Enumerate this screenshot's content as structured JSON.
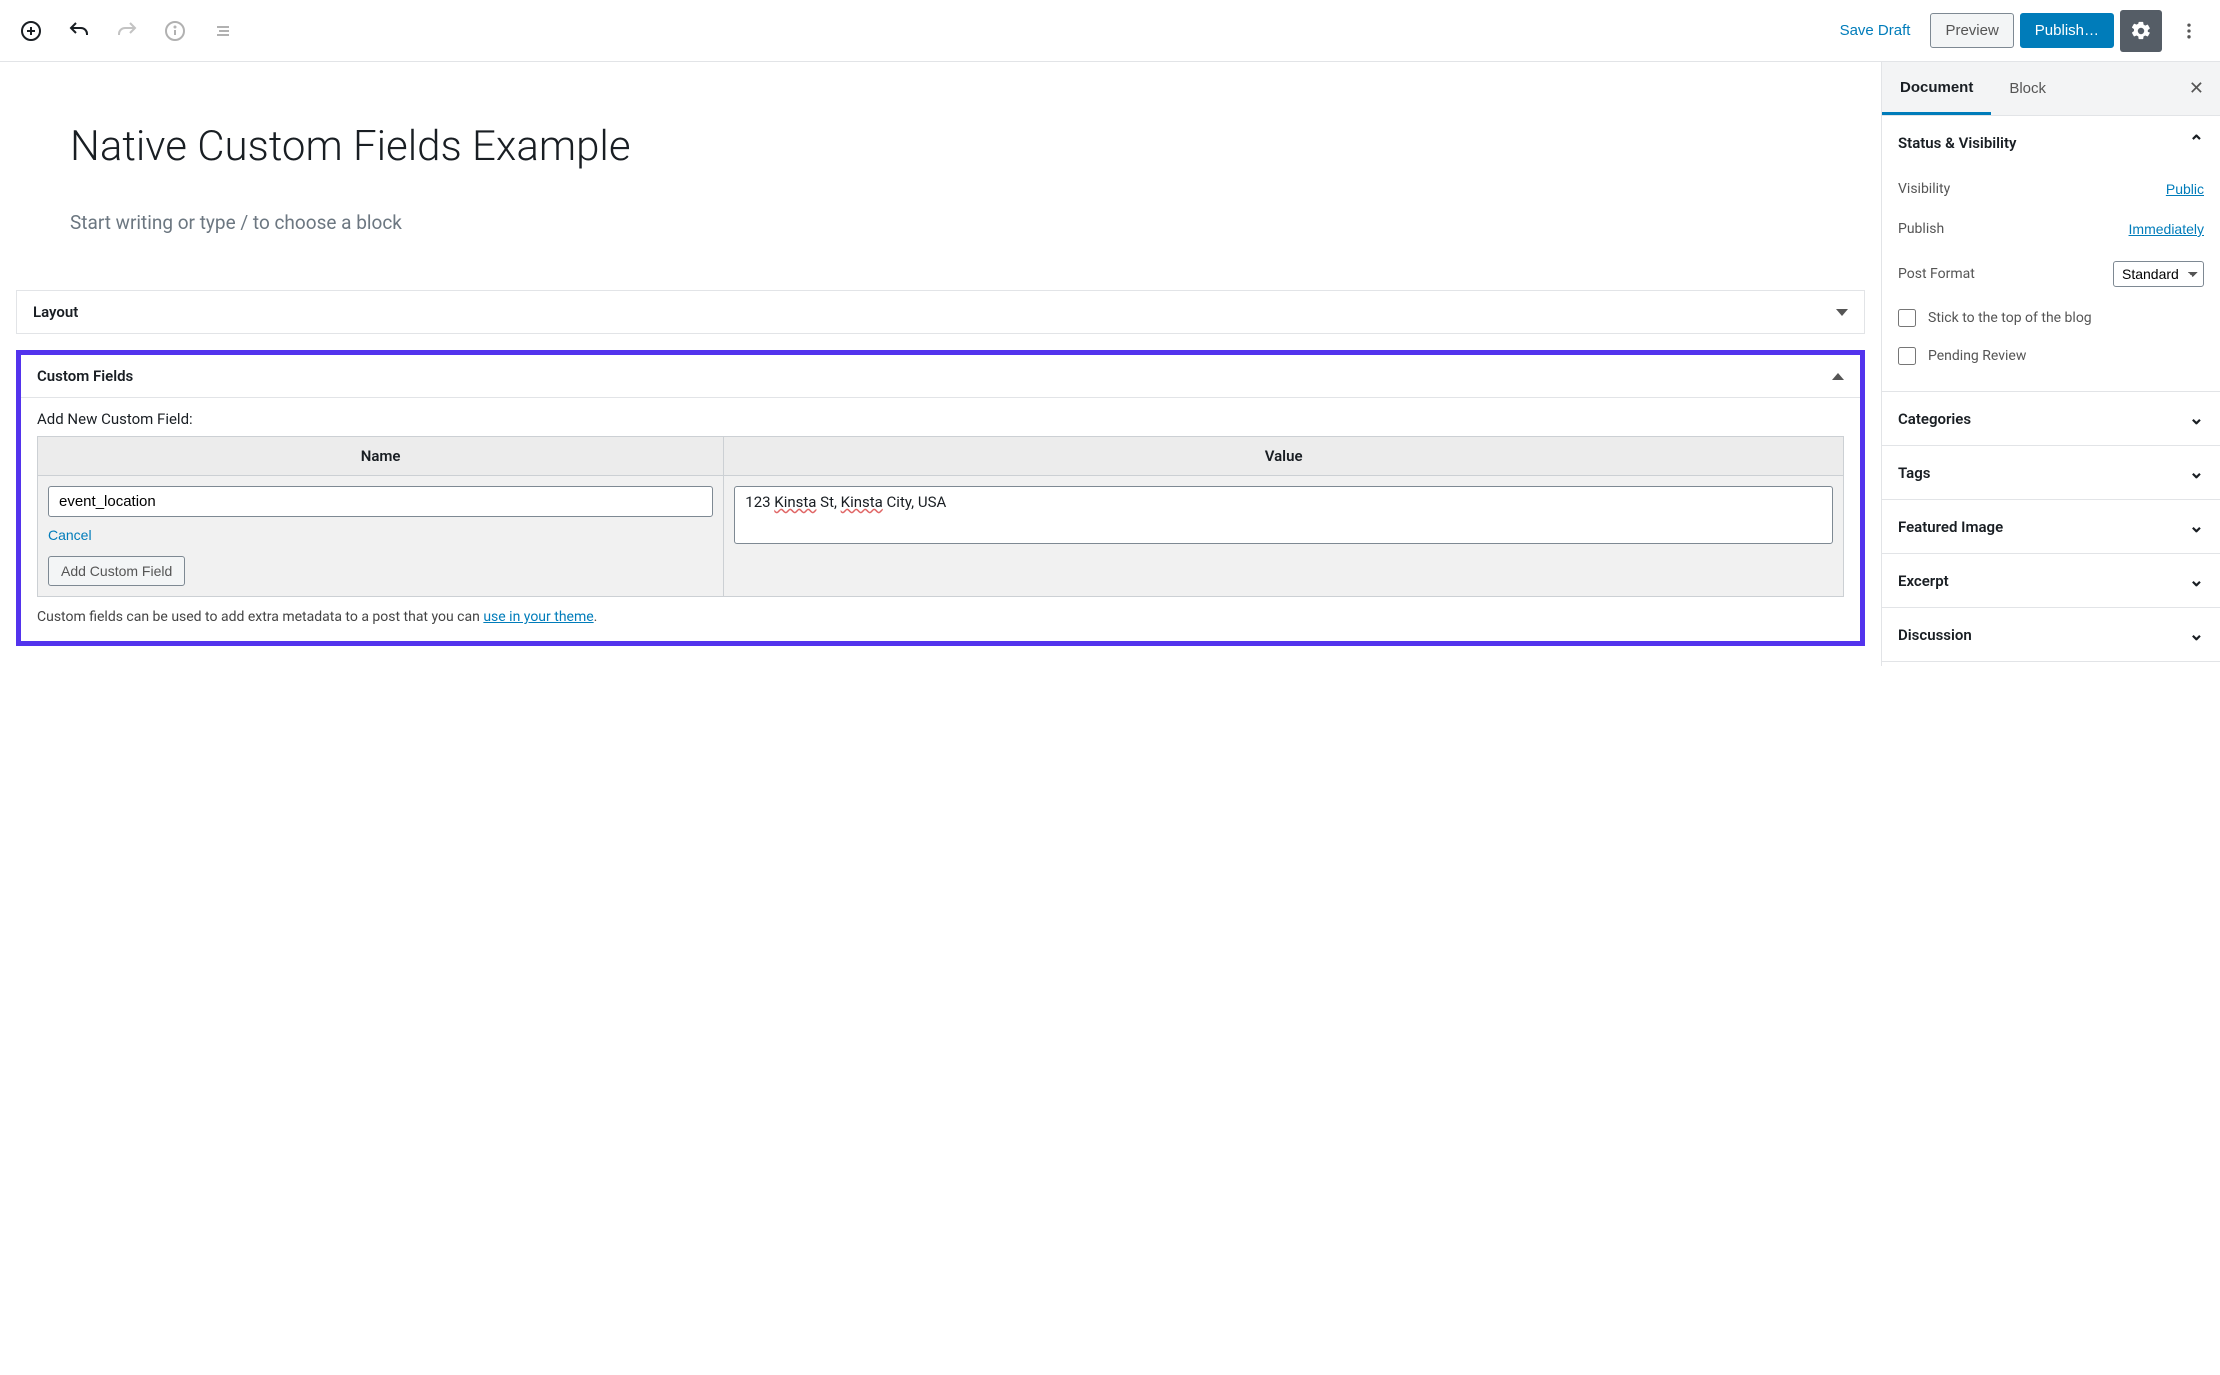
{
  "toolbar": {
    "save_draft": "Save Draft",
    "preview": "Preview",
    "publish": "Publish…"
  },
  "editor": {
    "title": "Native Custom Fields Example",
    "block_placeholder": "Start writing or type / to choose a block"
  },
  "metaboxes": {
    "layout": {
      "title": "Layout"
    },
    "custom_fields": {
      "title": "Custom Fields",
      "add_new_label": "Add New Custom Field:",
      "name_header": "Name",
      "value_header": "Value",
      "name_value": "event_location",
      "value_prefix": "123 ",
      "value_word1": "Kinsta",
      "value_mid1": " St, ",
      "value_word2": "Kinsta",
      "value_suffix": " City, USA",
      "cancel": "Cancel",
      "add_button": "Add Custom Field",
      "help_prefix": "Custom fields can be used to add extra metadata to a post that you can ",
      "help_link": "use in your theme",
      "help_suffix": "."
    }
  },
  "sidebar": {
    "tabs": {
      "document": "Document",
      "block": "Block"
    },
    "status": {
      "title": "Status & Visibility",
      "visibility_label": "Visibility",
      "visibility_value": "Public",
      "publish_label": "Publish",
      "publish_value": "Immediately",
      "post_format_label": "Post Format",
      "post_format_value": "Standard",
      "stick_label": "Stick to the top of the blog",
      "pending_label": "Pending Review"
    },
    "panels": {
      "categories": "Categories",
      "tags": "Tags",
      "featured_image": "Featured Image",
      "excerpt": "Excerpt",
      "discussion": "Discussion"
    }
  }
}
